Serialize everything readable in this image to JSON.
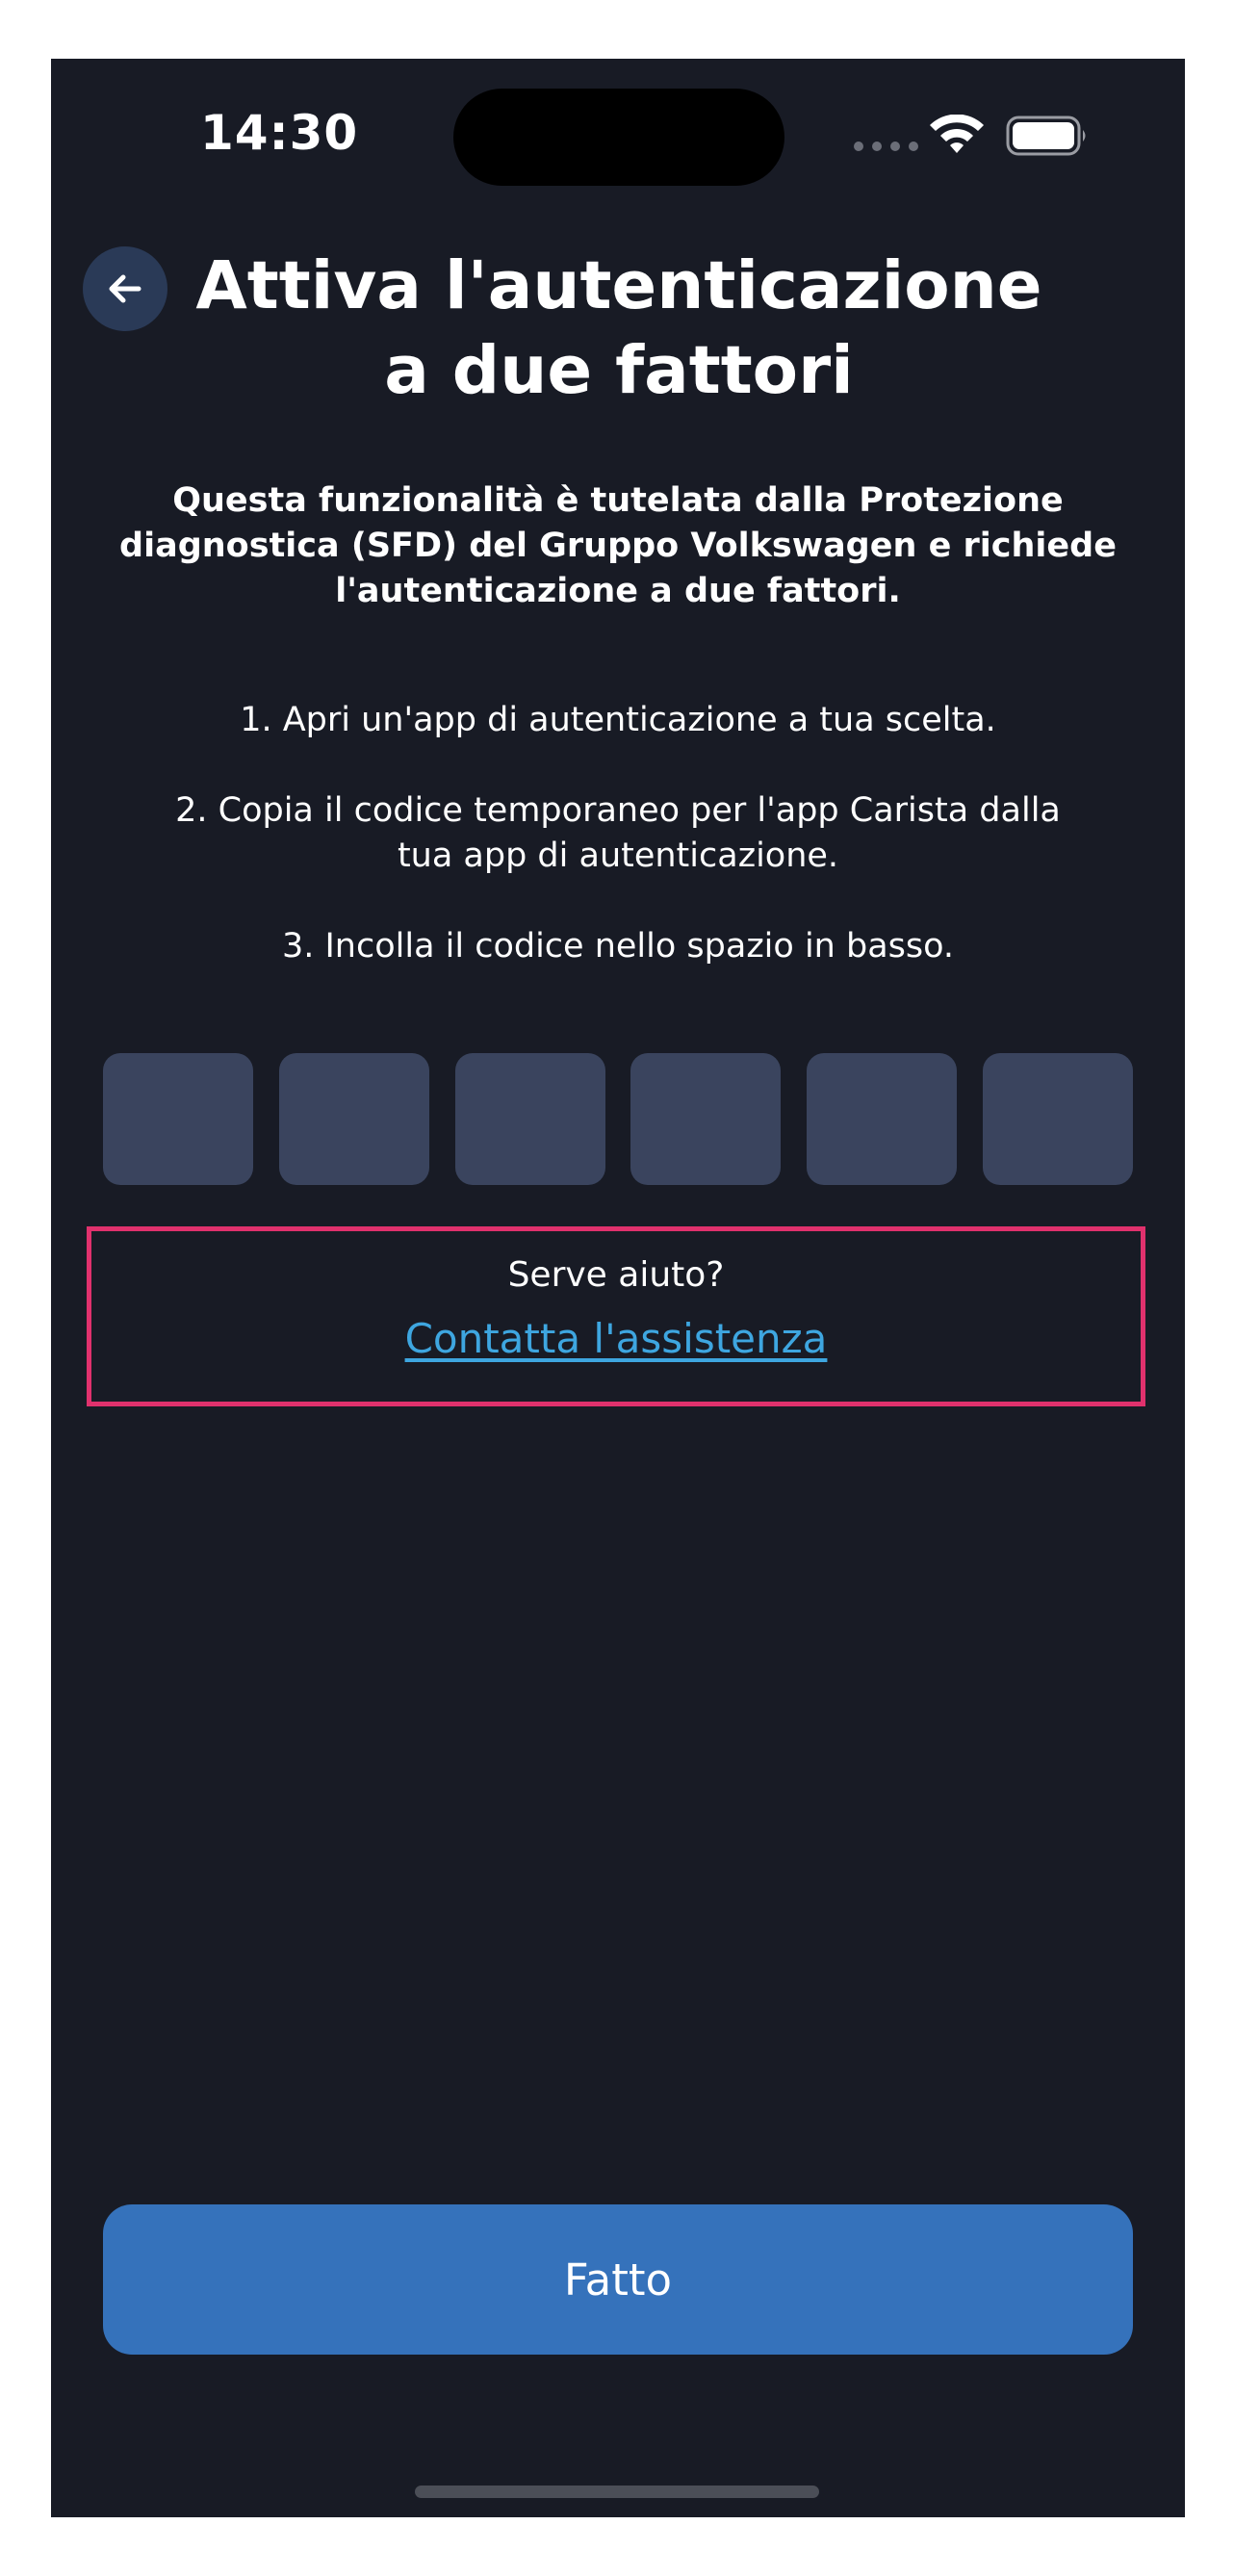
{
  "status_bar": {
    "time": "14:30",
    "icons": [
      "cellular-signal-icon",
      "wifi-icon",
      "battery-icon"
    ]
  },
  "header": {
    "back_icon": "arrow-left-icon",
    "title_line1": "Attiva l'autenticazione",
    "title_line2": "a due fattori"
  },
  "intro": {
    "line1": "Questa funzionalità è tutelata dalla Protezione",
    "line2": "diagnostica (SFD) del Gruppo Volkswagen e richiede",
    "line3": "l'autenticazione a due fattori."
  },
  "steps": {
    "step1": "1. Apri un'app di autenticazione a tua scelta.",
    "step2_line1": "2. Copia il codice temporaneo per l'app Carista dalla",
    "step2_line2": "tua app di autenticazione.",
    "step3": "3. Incolla il codice nello spazio in basso."
  },
  "code_inputs": [
    "",
    "",
    "",
    "",
    "",
    ""
  ],
  "help": {
    "label": "Serve aiuto?",
    "link": "Contatta l'assistenza"
  },
  "actions": {
    "done_label": "Fatto"
  },
  "colors": {
    "background": "#181b25",
    "code_box": "#3a445e",
    "accent_button": "#3572bb",
    "link": "#3ea6e0",
    "highlight_border": "#e0316d"
  }
}
